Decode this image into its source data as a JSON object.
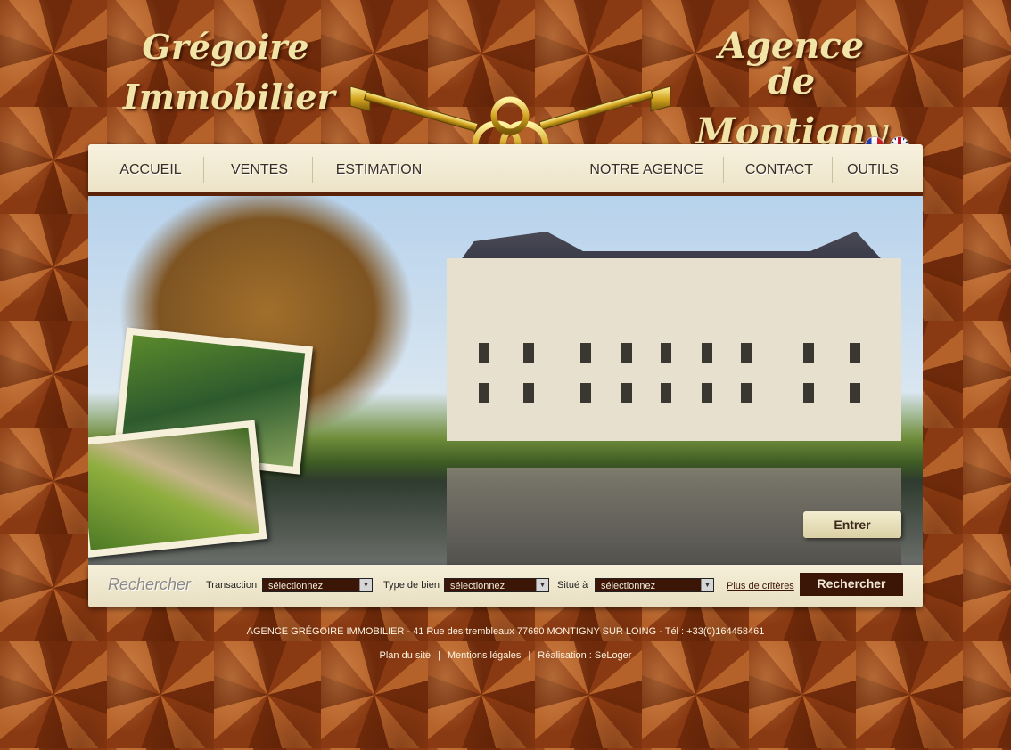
{
  "brand": {
    "left_line1": "Grégoire",
    "left_line2": "Immobilier",
    "right_line1": "Agence de",
    "right_line2": "Montigny"
  },
  "languages": [
    {
      "code": "fr",
      "icon": "french-flag-icon"
    },
    {
      "code": "en",
      "icon": "uk-flag-icon"
    }
  ],
  "nav": {
    "items": [
      "ACCUEIL",
      "VENTES",
      "ESTIMATION",
      "NOTRE AGENCE",
      "CONTACT",
      "OUTILS"
    ]
  },
  "hero": {
    "enter_label": "Entrer"
  },
  "search": {
    "title": "Rechercher",
    "transaction_label": "Transaction",
    "transaction_value": "sélectionnez",
    "type_label": "Type de bien",
    "type_value": "sélectionnez",
    "location_label": "Situé à",
    "location_value": "sélectionnez",
    "more_criteria": "Plus de critères",
    "submit_label": "Rechercher"
  },
  "footer": {
    "address": "AGENCE GRÉGOIRE IMMOBILIER - 41 Rue des trembleaux 77690 MONTIGNY SUR LOING  - Tél : +33(0)164458461",
    "links": [
      "Plan du site",
      "Mentions légales",
      "Réalisation : SeLoger"
    ],
    "separator": "|"
  },
  "colors": {
    "accent_dark": "#3b1505",
    "cream": "#f5efd9",
    "gold_text": "#f2e4a6"
  }
}
